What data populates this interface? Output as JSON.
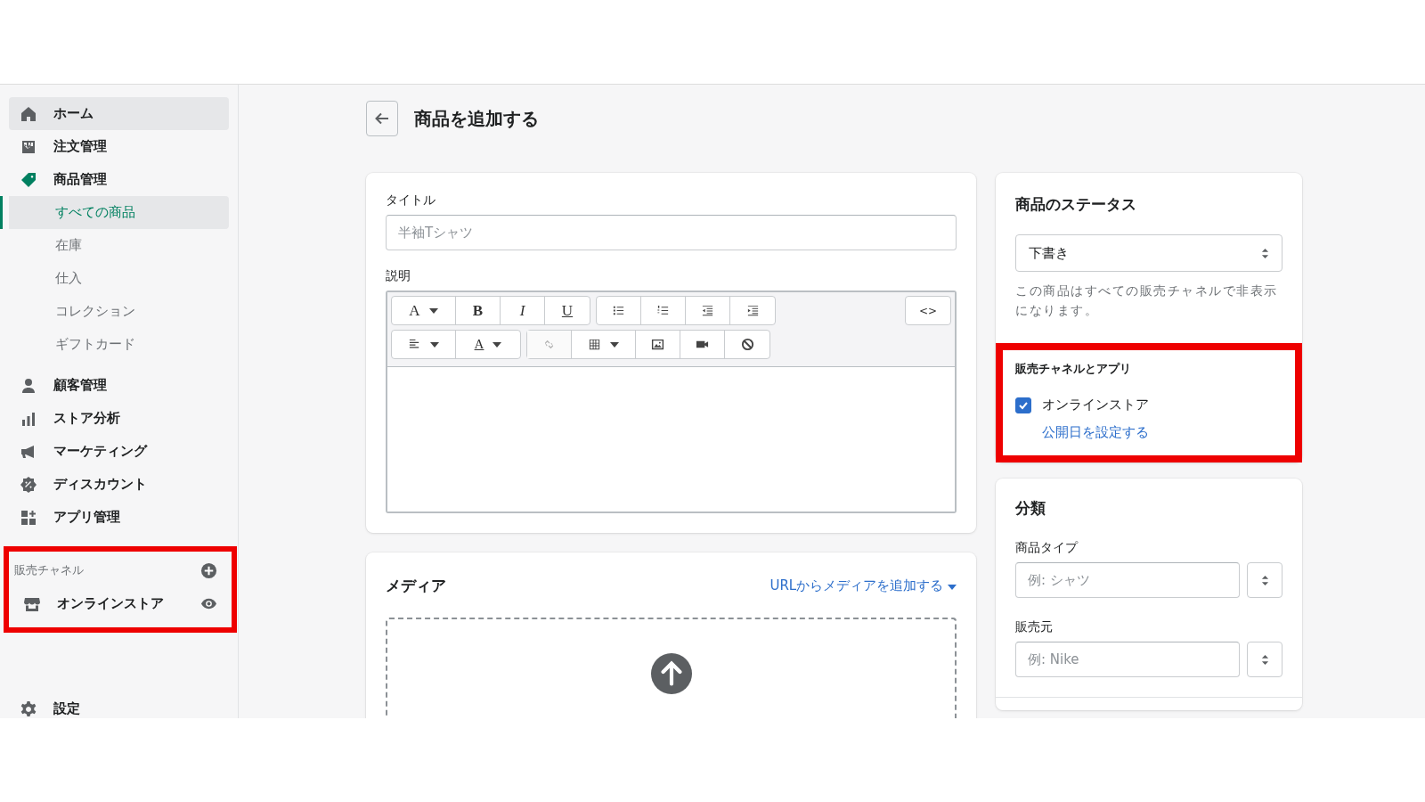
{
  "sidebar": {
    "items": [
      {
        "label": "ホーム",
        "hovered": true,
        "selected": false
      },
      {
        "label": "注文管理",
        "hovered": false,
        "selected": false
      },
      {
        "label": "商品管理",
        "hovered": false,
        "selected": true,
        "children": [
          {
            "label": "すべての商品",
            "selected": true
          },
          {
            "label": "在庫",
            "selected": false
          },
          {
            "label": "仕入",
            "selected": false
          },
          {
            "label": "コレクション",
            "selected": false
          },
          {
            "label": "ギフトカード",
            "selected": false
          }
        ]
      },
      {
        "label": "顧客管理",
        "hovered": false,
        "selected": false
      },
      {
        "label": "ストア分析",
        "hovered": false,
        "selected": false
      },
      {
        "label": "マーケティング",
        "hovered": false,
        "selected": false
      },
      {
        "label": "ディスカウント",
        "hovered": false,
        "selected": false
      },
      {
        "label": "アプリ管理",
        "hovered": false,
        "selected": false
      }
    ],
    "sales_channels": {
      "heading": "販売チャネル",
      "highlighted": true,
      "items": [
        {
          "label": "オンラインストア"
        }
      ]
    },
    "settings": {
      "label": "設定"
    }
  },
  "page": {
    "title": "商品を追加する"
  },
  "product": {
    "title_field": {
      "label": "タイトル",
      "placeholder": "半袖Tシャツ"
    },
    "description": {
      "label": "説明",
      "toolbar": [
        [
          [
            {
              "kind": "font",
              "text": "A",
              "dropdown": true
            },
            {
              "kind": "bold",
              "text": "B",
              "dropdown": false
            },
            {
              "kind": "italic",
              "text": "I",
              "dropdown": false
            },
            {
              "kind": "underline",
              "text": "U",
              "dropdown": false
            }
          ],
          [
            {
              "kind": "bullets",
              "dropdown": false
            },
            {
              "kind": "numbers",
              "dropdown": false
            },
            {
              "kind": "outdent",
              "dropdown": false
            },
            {
              "kind": "indent",
              "dropdown": false
            }
          ],
          [
            {
              "kind": "code",
              "text": "<>",
              "dropdown": false
            }
          ]
        ],
        [
          [
            {
              "kind": "align",
              "dropdown": true
            },
            {
              "kind": "text-color",
              "text": "A",
              "dropdown": true
            }
          ],
          [
            {
              "kind": "link",
              "dropdown": false,
              "disabled": true
            },
            {
              "kind": "table",
              "dropdown": true
            },
            {
              "kind": "image",
              "dropdown": false
            },
            {
              "kind": "video",
              "dropdown": false
            },
            {
              "kind": "clear",
              "dropdown": false
            }
          ]
        ]
      ]
    }
  },
  "media": {
    "heading": "メディア",
    "link": "URLからメディアを追加する"
  },
  "status": {
    "heading": "商品のステータス",
    "value": "下書き",
    "help": "この商品はすべての販売チャネルで非表示になります。"
  },
  "channels": {
    "heading": "販売チャネルとアプリ",
    "highlighted": true,
    "items": [
      {
        "label": "オンラインストア",
        "checked": true
      }
    ],
    "link": "公開日を設定する"
  },
  "organization": {
    "heading": "分類",
    "fields": [
      {
        "label": "商品タイプ",
        "placeholder": "例: シャツ"
      },
      {
        "label": "販売元",
        "placeholder": "例: Nike"
      }
    ]
  }
}
